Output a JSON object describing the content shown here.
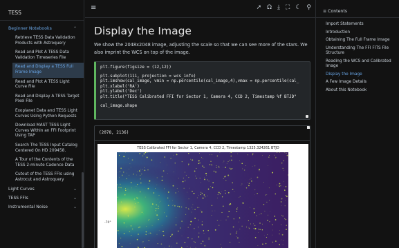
{
  "sidebar": {
    "site_title": "TESS",
    "expanded_section": "Beginner Notebooks",
    "items": [
      {
        "label": "Retrieve TESS Data Validation Products with Astroquery"
      },
      {
        "label": "Read and Plot A TESS Data Validation Timeseries File"
      },
      {
        "label": "Read and Display a TESS Full Frame Image"
      },
      {
        "label": "Read and Plot A TESS Light Curve File"
      },
      {
        "label": "Read and Display A TESS Target Pixel File"
      },
      {
        "label": "Exoplanet Data and TESS Light Curves Using Python Requests"
      },
      {
        "label": "Download MAST TESS Light Curves Within an FFI Footprint Using TAP"
      },
      {
        "label": "Search The TESS Input Catalog Centered On HD 209458."
      },
      {
        "label": "A Tour of the Contents of the TESS 2-minute Cadence Data"
      },
      {
        "label": "Cutout of the TESS FFIs using Astrocut and Astroquery"
      }
    ],
    "active_index": 2,
    "sections": [
      {
        "label": "Light Curves"
      },
      {
        "label": "TESS FFIs"
      },
      {
        "label": "Instrumental Noise"
      }
    ]
  },
  "header": {
    "menu_icon": "≡",
    "icons": [
      "rocket-icon",
      "github-icon",
      "download-icon",
      "fullscreen-icon",
      "moon-icon",
      "search-icon"
    ],
    "icon_glyphs": [
      "➚",
      "Ω",
      "⤓",
      "⛶",
      "☾",
      "⚲"
    ]
  },
  "main": {
    "title": "Display the Image",
    "paragraph": "We show the 2048x2048 image, adjusting the scale so that we can see more of the stars. We also imprint the WCS on top of the image.",
    "code_lines": [
      "plt.figure(figsize = (12,12))",
      "",
      "plt.subplot(111, projection = wcs_info)",
      "plt.imshow(cal_image, vmin = np.percentile(cal_image,4),vmax = np.percentile(cal_",
      "plt.xlabel('RA')",
      "plt.ylabel('Dec')",
      "plt.title(\"TESS Calibrated FFI for Sector 1, Camera 4, CCD 2, Timestamp %f BTJD\"",
      "",
      "cal_image.shape"
    ],
    "output": "(2078, 2136)",
    "plot_title": "TESS Calibrated FFI for Sector 1, Camera 4, CCD 2, Timestamp 1325.324261 BTJD",
    "y_tick": "-70°"
  },
  "toc": {
    "heading": "Contents",
    "heading_icon": "≡",
    "items": [
      {
        "label": "Import Statements"
      },
      {
        "label": "Introduction"
      },
      {
        "label": "Obtaining The Full Frame Image"
      },
      {
        "label": "Understanding The FFI FITS File Structure"
      },
      {
        "label": "Reading the WCS and Calibrated Image"
      },
      {
        "label": "Display the Image"
      },
      {
        "label": "A Few Image Details"
      },
      {
        "label": "About this Notebook"
      }
    ],
    "active_index": 5
  },
  "colors": {
    "accent": "#6aa7e8",
    "code_border": "#5fb65f",
    "background": "#121212"
  }
}
